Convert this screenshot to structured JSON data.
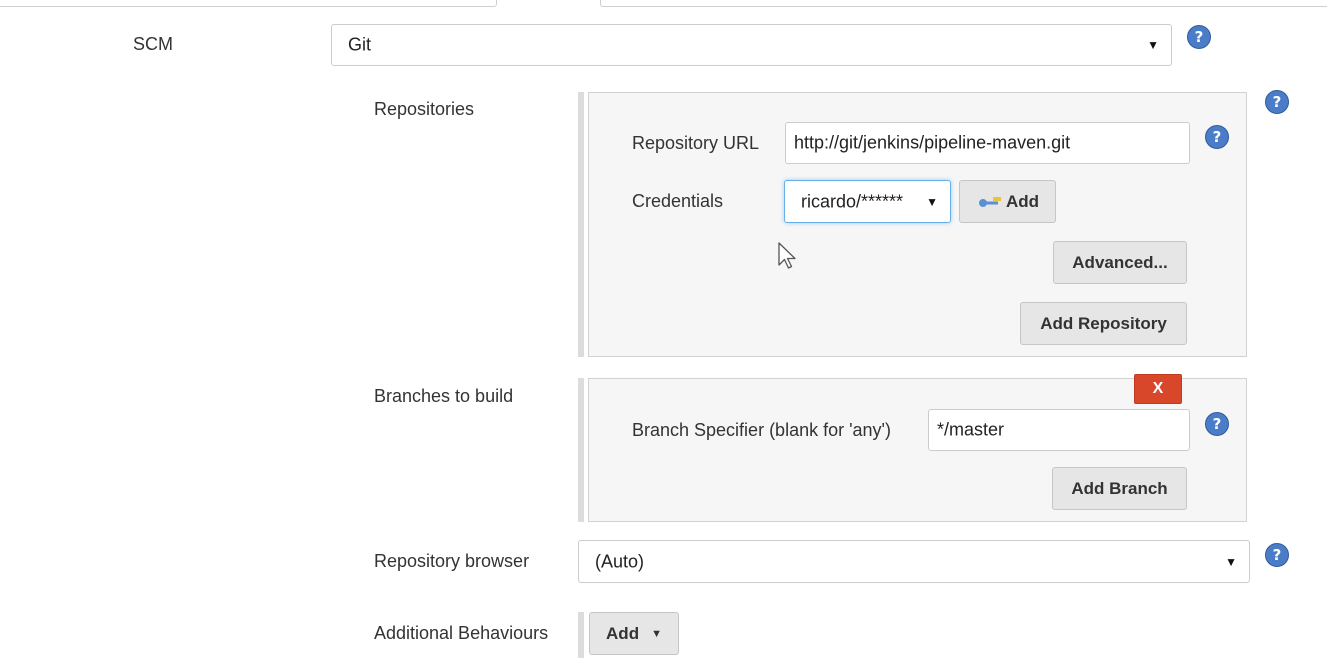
{
  "scm": {
    "label": "SCM",
    "value": "Git"
  },
  "repositories": {
    "label": "Repositories",
    "url_label": "Repository URL",
    "url_value": "http://git/jenkins/pipeline-maven.git",
    "credentials_label": "Credentials",
    "credentials_value": "ricardo/******",
    "add_credentials_label": "Add",
    "advanced_label": "Advanced...",
    "add_repository_label": "Add Repository"
  },
  "branches": {
    "label": "Branches to build",
    "delete_label": "X",
    "specifier_label": "Branch Specifier (blank for 'any')",
    "specifier_value": "*/master",
    "add_branch_label": "Add Branch"
  },
  "repository_browser": {
    "label": "Repository browser",
    "value": "(Auto)"
  },
  "additional_behaviours": {
    "label": "Additional Behaviours",
    "add_label": "Add"
  },
  "icons": {
    "help": "help-icon",
    "caret": "caret-down-icon",
    "key": "key-icon",
    "cursor": "mouse-cursor-icon"
  },
  "colors": {
    "help_blue": "#4a7cc7",
    "delete_red": "#d9472b",
    "panel_bg": "#f6f6f6",
    "button_bg": "#e6e6e6"
  }
}
